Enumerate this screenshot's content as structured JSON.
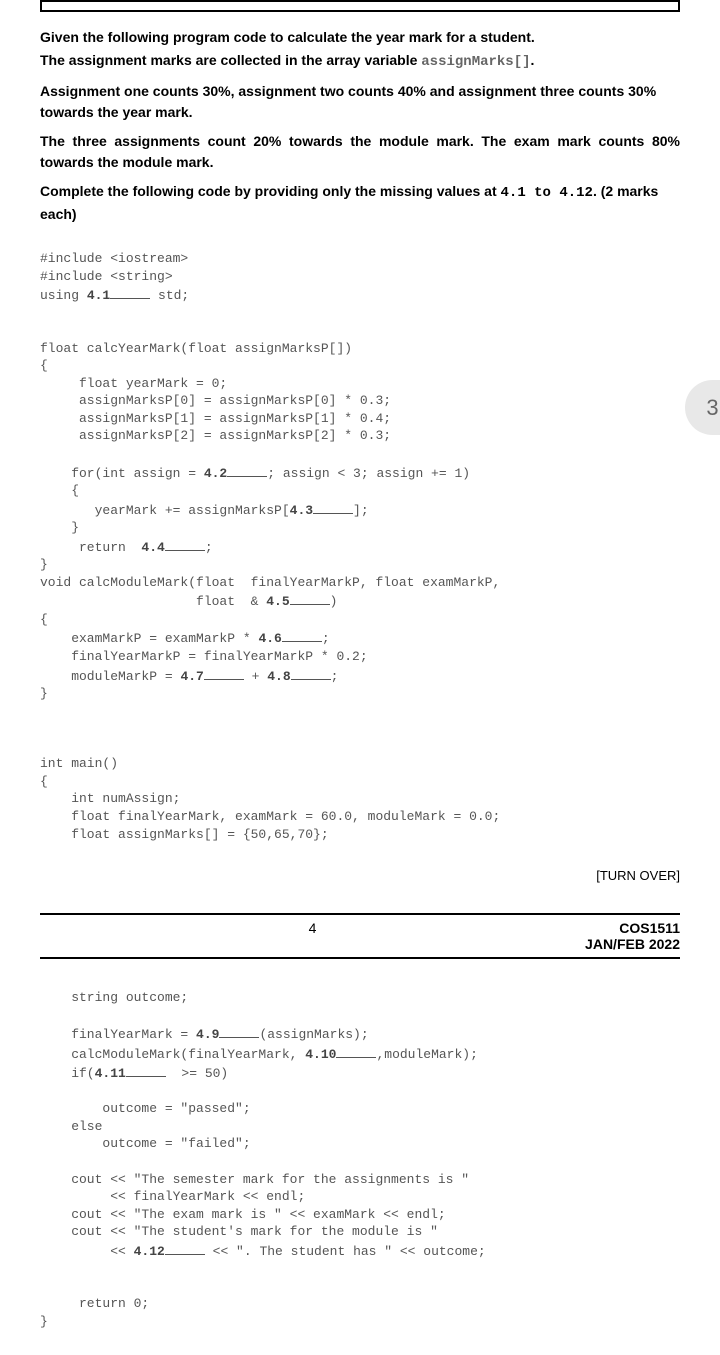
{
  "intro": {
    "p1a": "Given the following program code to calculate the year mark for a student.",
    "p1b_prefix": "The assignment marks are collected in the array variable ",
    "p1b_mono": "assignMarks[]",
    "p1b_suffix": ".",
    "p2": "Assignment one counts 30%, assignment two counts 40% and assignment three counts 30% towards the year mark.",
    "p3": "The three assignments count 20% towards the module mark. The exam mark counts 80% towards the module mark.",
    "p4_prefix": "Complete the following code by providing only the missing values at ",
    "p4_m1": "4.1",
    "p4_mid": " to ",
    "p4_m2": "4.12",
    "p4_suffix": ".   (2 marks each)"
  },
  "badge": "3",
  "turn_over": "[TURN OVER]",
  "footer": {
    "page_num": "4",
    "code": "COS1511",
    "term": "JAN/FEB 2022"
  },
  "code1": {
    "l1": "#include <iostream>",
    "l2": "#include <string>",
    "l3a": "using ",
    "l3b": "4.1",
    "l3c": " std;",
    "l4": "float calcYearMark(float assignMarksP[])",
    "l5": "{",
    "l6": "     float yearMark = 0;",
    "l7": "     assignMarksP[0] = assignMarksP[0] * 0.3;",
    "l8": "     assignMarksP[1] = assignMarksP[1] * 0.4;",
    "l9": "     assignMarksP[2] = assignMarksP[2] * 0.3;",
    "l10a": "    for(int assign = ",
    "l10b": "4.2",
    "l10c": "; assign < 3; assign += 1)",
    "l11": "    {",
    "l12a": "       yearMark += assignMarksP[",
    "l12b": "4.3",
    "l12c": "];",
    "l13": "    }",
    "l14a": "     return  ",
    "l14b": "4.4",
    "l14c": ";",
    "l15": "}",
    "l16": "void calcModuleMark(float  finalYearMarkP, float examMarkP,",
    "l17a": "                    float  & ",
    "l17b": "4.5",
    "l17c": ")",
    "l18": "{",
    "l19a": "    examMarkP = examMarkP * ",
    "l19b": "4.6",
    "l19c": ";",
    "l20": "    finalYearMarkP = finalYearMarkP * 0.2;",
    "l21a": "    moduleMarkP = ",
    "l21b": "4.7",
    "l21c": " + ",
    "l21d": "4.8",
    "l21e": ";",
    "l22": "}",
    "l23": "int main()",
    "l24": "{",
    "l25": "    int numAssign;",
    "l26": "    float finalYearMark, examMark = 60.0, moduleMark = 0.0;",
    "l27": "    float assignMarks[] = {50,65,70};"
  },
  "code2": {
    "l1": "    string outcome;",
    "l2a": "    finalYearMark = ",
    "l2b": "4.9",
    "l2c": "(assignMarks);",
    "l3a": "    calcModuleMark(finalYearMark, ",
    "l3b": "4.10",
    "l3c": ",moduleMark);",
    "l4a": "    if(",
    "l4b": "4.11",
    "l4c": "  >= 50)",
    "l5": "        outcome = \"passed\";",
    "l6": "    else",
    "l7": "        outcome = \"failed\";",
    "l8": "    cout << \"The semester mark for the assignments is \"",
    "l9": "         << finalYearMark << endl;",
    "l10": "    cout << \"The exam mark is \" << examMark << endl;",
    "l11": "    cout << \"The student's mark for the module is \"",
    "l12a": "         << ",
    "l12b": "4.12",
    "l12c": " << \". The student has \" << outcome;",
    "l13": "     return 0;",
    "l14": "}"
  }
}
